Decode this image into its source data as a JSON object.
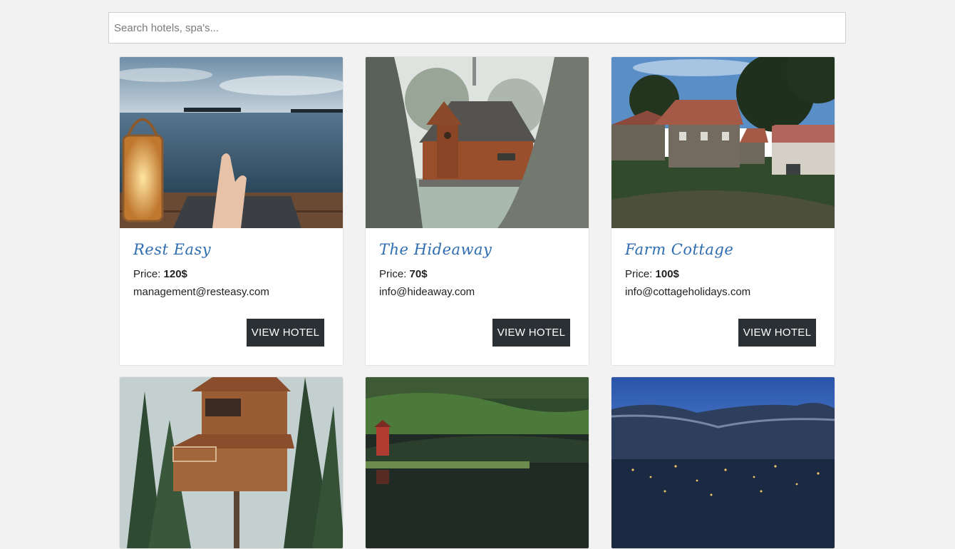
{
  "search": {
    "placeholder": "Search hotels, spa's..."
  },
  "hotels": [
    {
      "name": "Rest Easy",
      "price_label": "Price:",
      "price": "120$",
      "email": "management@resteasy.com",
      "button": "VIEW HOTEL"
    },
    {
      "name": "The Hideaway",
      "price_label": "Price:",
      "price": "70$",
      "email": "info@hideaway.com",
      "button": "VIEW HOTEL"
    },
    {
      "name": "Farm Cottage",
      "price_label": "Price:",
      "price": "100$",
      "email": "info@cottageholidays.com",
      "button": "VIEW HOTEL"
    },
    {
      "name": "",
      "image": "treehouse"
    },
    {
      "name": "",
      "image": "lake-forest"
    },
    {
      "name": "",
      "image": "city-mountains-night"
    }
  ],
  "colors": {
    "title": "#2f6db2",
    "button_bg": "#2b3035",
    "page_bg": "#f2f2f2"
  }
}
